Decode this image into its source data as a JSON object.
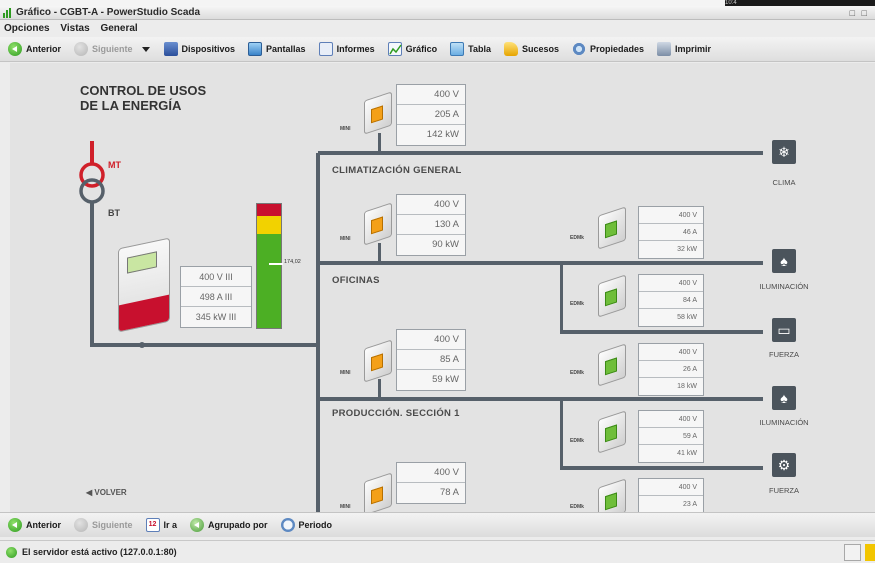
{
  "window": {
    "title": "Gráfico - CGBT-A - PowerStudio Scada",
    "topstrip_text": "10:4",
    "window_buttons": "□ □"
  },
  "menu": [
    "Opciones",
    "Vistas",
    "General"
  ],
  "toolbar": {
    "back": "Anterior",
    "next": "Siguiente",
    "devices": "Dispositivos",
    "screens": "Pantallas",
    "reports": "Informes",
    "chart": "Gráfico",
    "table": "Tabla",
    "events": "Sucesos",
    "properties": "Propiedades",
    "print": "Imprimir"
  },
  "diagram": {
    "title_line1": "CONTROL DE USOS",
    "title_line2": "DE LA ENERGÍA",
    "mt_label": "MT",
    "bt_label": "BT",
    "main_meter": [
      "400 V III",
      "498 A III",
      "345 kW III"
    ],
    "bar_value": "174,02",
    "bar_level": 0.73,
    "sections": [
      "CLIMATIZACIÓN GENERAL",
      "OFICINAS",
      "PRODUCCIÓN. SECCIÓN 1"
    ],
    "back_link": "◀ VOLVER",
    "devices": {
      "mini_label": "MINI",
      "edmk_label": "EDMk"
    },
    "feeder_meters": [
      [
        "400 V",
        "205 A",
        "142 kW"
      ],
      [
        "400 V",
        "130 A",
        "90 kW"
      ],
      [
        "400 V",
        "85 A",
        "59 kW"
      ],
      [
        "400 V",
        "78 A"
      ]
    ],
    "sub_meters": [
      [
        "400 V",
        "46 A",
        "32 kW"
      ],
      [
        "400 V",
        "84 A",
        "58 kW"
      ],
      [
        "400 V",
        "26 A",
        "18 kW"
      ],
      [
        "400 V",
        "59 A",
        "41 kW"
      ],
      [
        "400 V",
        "23 A"
      ]
    ],
    "endpoints": [
      {
        "label": "CLIMA",
        "icon": "snowflake-icon"
      },
      {
        "label": "ILUMINACIÓN",
        "icon": "bulb-icon"
      },
      {
        "label": "FUERZA",
        "icon": "laptop-icon"
      },
      {
        "label": "ILUMINACIÓN",
        "icon": "bulb-icon"
      },
      {
        "label": "FUERZA",
        "icon": "gears-icon"
      }
    ],
    "glyphs": {
      "snow": "❄",
      "bulb": "♠",
      "laptop": "▭",
      "gears": "⚙"
    }
  },
  "bottom_toolbar": {
    "back": "Anterior",
    "next": "Siguiente",
    "goto": "Ir a",
    "grouped": "Agrupado por",
    "period": "Periodo",
    "goto_badge": "12"
  },
  "status": {
    "text": "El servidor está activo (127.0.0.1:80)"
  },
  "colors": {
    "line": "#56606a",
    "bar_red": "#c8102e",
    "bar_yellow": "#f2d200",
    "bar_green": "#4caf24",
    "transformer_red": "#d0202a"
  }
}
